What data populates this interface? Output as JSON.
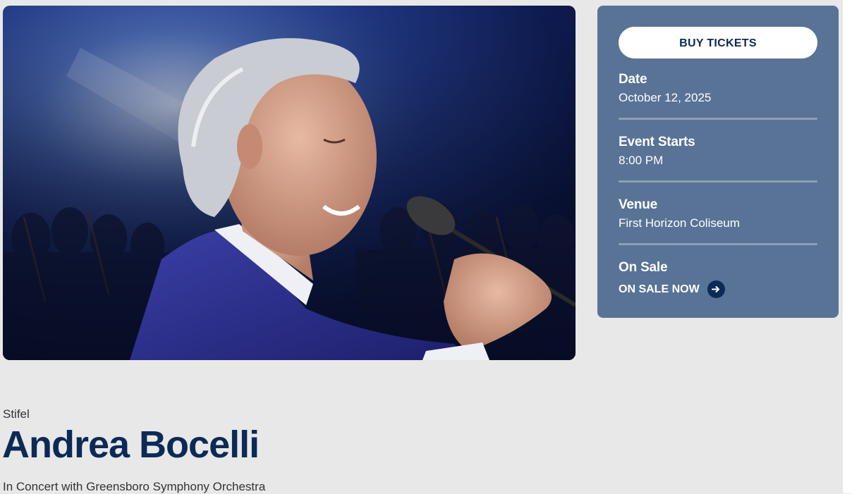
{
  "card": {
    "buy_button": "BUY TICKETS",
    "date_label": "Date",
    "date_value": "October 12, 2025",
    "starts_label": "Event Starts",
    "starts_value": "8:00 PM",
    "venue_label": "Venue",
    "venue_value": "First Horizon Coliseum",
    "onsale_label": "On Sale",
    "onsale_link": "ON SALE NOW",
    "arrow_icon": "arrow-right-circle-icon"
  },
  "event": {
    "sponsor": "Stifel",
    "title": "Andrea Bocelli",
    "subtitle": "In Concert with Greensboro Symphony Orchestra"
  },
  "colors": {
    "page_bg": "#e8e8e8",
    "card_bg": "#587395",
    "brand_navy": "#0c2a55",
    "button_bg": "#ffffff"
  }
}
